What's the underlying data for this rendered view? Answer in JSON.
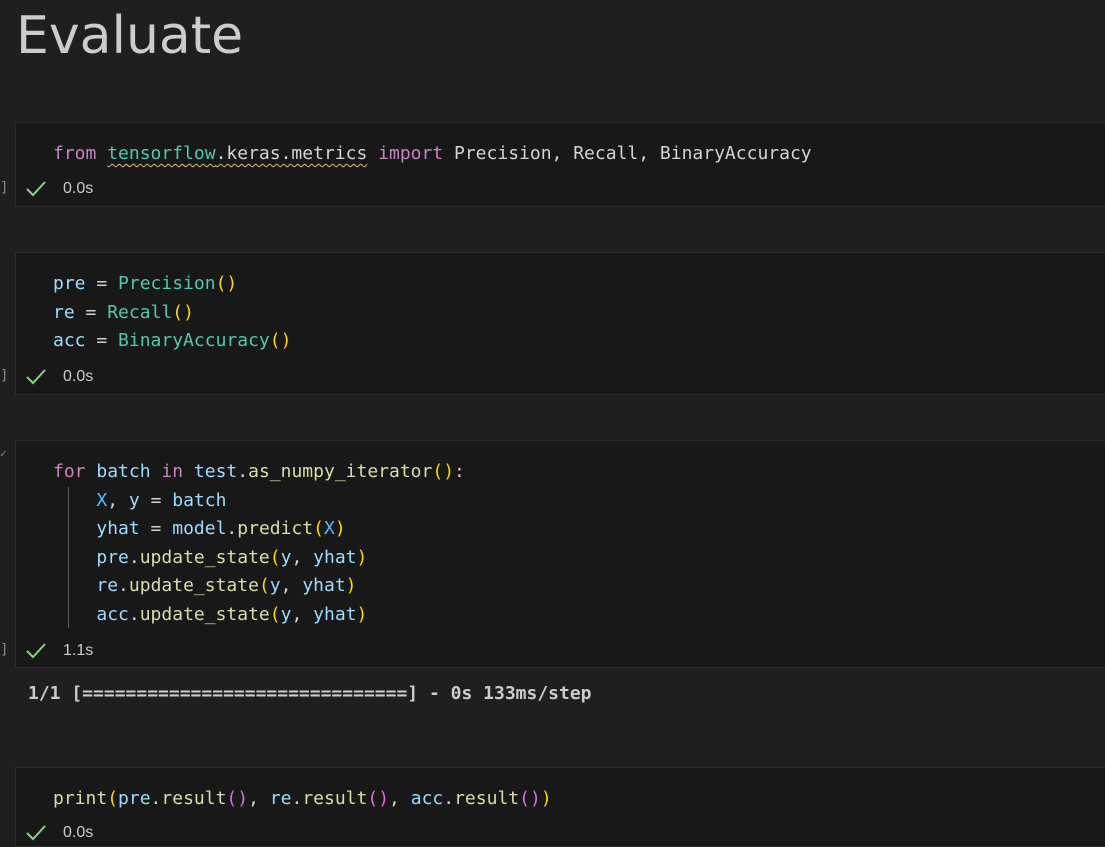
{
  "section_heading": "Evaluate",
  "cells": [
    {
      "code_lines": [
        [
          "from",
          " ",
          "tensorflow",
          ".keras.metrics",
          " ",
          "import",
          " Precision, Recall, BinaryAccuracy"
        ]
      ],
      "exec_time": "0.0s"
    },
    {
      "code_lines": [
        [
          "pre",
          " = ",
          "Precision",
          "(",
          ")"
        ],
        [
          "re",
          " = ",
          "Recall",
          "(",
          ")"
        ],
        [
          "acc",
          " = ",
          "BinaryAccuracy",
          "(",
          ")"
        ]
      ],
      "exec_time": "0.0s"
    },
    {
      "code_lines": [
        [
          "for",
          " ",
          "batch",
          " ",
          "in",
          " ",
          "test",
          ".",
          "as_numpy_iterator",
          "(",
          ")",
          ":"
        ],
        [
          "    ",
          "X",
          ", ",
          "y",
          " = ",
          "batch"
        ],
        [
          "    ",
          "yhat",
          " = ",
          "model",
          ".",
          "predict",
          "(",
          "X",
          ")"
        ],
        [
          "    ",
          "pre",
          ".",
          "update_state",
          "(",
          "y",
          ", ",
          "yhat",
          ")"
        ],
        [
          "    ",
          "re",
          ".",
          "update_state",
          "(",
          "y",
          ", ",
          "yhat",
          ")"
        ],
        [
          "    ",
          "acc",
          ".",
          "update_state",
          "(",
          "y",
          ", ",
          "yhat",
          ")"
        ]
      ],
      "exec_time": "1.1s",
      "output": "1/1 [==============================] - 0s 133ms/step"
    },
    {
      "code_lines": [
        [
          "print",
          "(",
          "pre",
          ".",
          "result",
          "(",
          ")",
          ", ",
          "re",
          ".",
          "result",
          "(",
          ")",
          ", ",
          "acc",
          ".",
          "result",
          "(",
          ")",
          ")"
        ]
      ],
      "exec_time": "0.0s"
    }
  ],
  "gutter_marks": [
    "]",
    "]",
    "]",
    "✓"
  ],
  "colors": {
    "background": "#1f1f1f",
    "cell_background": "#181818",
    "keyword": "#c586c0",
    "variable": "#9cdcfe",
    "constant": "#4fc1ff",
    "function": "#dcdcaa",
    "module": "#4ec9b0",
    "bracket_level1": "#ffd700",
    "bracket_level2": "#da70d6",
    "bracket_level3": "#179fff",
    "success_check": "#89d185"
  },
  "icons": {
    "status": "check-icon"
  }
}
